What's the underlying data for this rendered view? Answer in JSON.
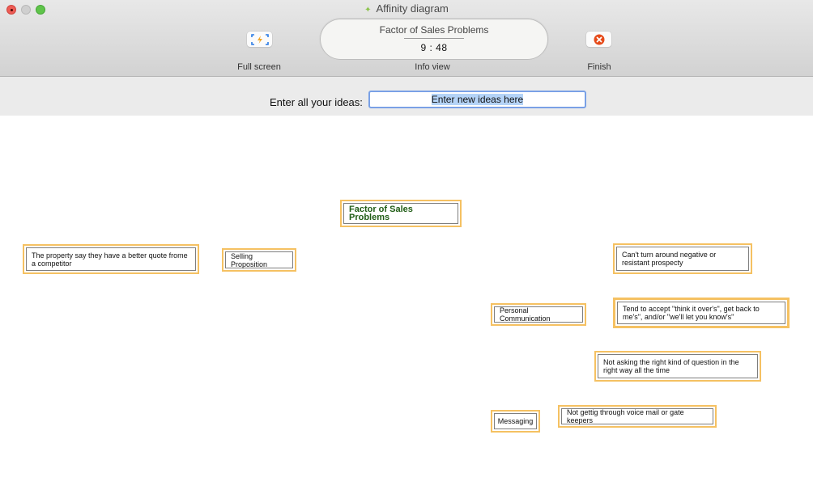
{
  "window": {
    "title": "Affinity diagram",
    "controls": [
      "close",
      "minimize",
      "maximize"
    ]
  },
  "toolbar": {
    "fullscreen": {
      "label": "Full screen",
      "icon": "fullscreen-icon"
    },
    "info_view": {
      "label": "Info view",
      "title": "Factor of Sales Problems",
      "timer": "9 : 48"
    },
    "finish": {
      "label": "Finish",
      "icon": "close-circle-icon",
      "icon_color": "#e64a19"
    }
  },
  "idea_bar": {
    "label": "Enter all your ideas:",
    "input_value": "Enter new ideas here"
  },
  "diagram": {
    "header": "Factor of Sales Problems",
    "cards": [
      {
        "text": "The property say they have a better quote frome a competitor",
        "type": "idea"
      },
      {
        "text": "Selling Proposition",
        "type": "group"
      },
      {
        "text": "Can't turn around negative or resistant prospecty",
        "type": "idea"
      },
      {
        "text": "Personal Communication",
        "type": "group"
      },
      {
        "text": "Tend  to accept \"think it over's\", get back to me's\", and/or \"we'll let you know's\"",
        "type": "idea"
      },
      {
        "text": "Not asking the right kind of question in the right way all the time",
        "type": "idea"
      },
      {
        "text": "Messaging",
        "type": "group"
      },
      {
        "text": "Not gettig through voice mail or gate keepers",
        "type": "idea"
      }
    ]
  },
  "colors": {
    "card_border": "#f5c162",
    "header_text": "#1f5c14",
    "input_focus": "#7aa1e6",
    "selection": "#b4d3f7"
  }
}
